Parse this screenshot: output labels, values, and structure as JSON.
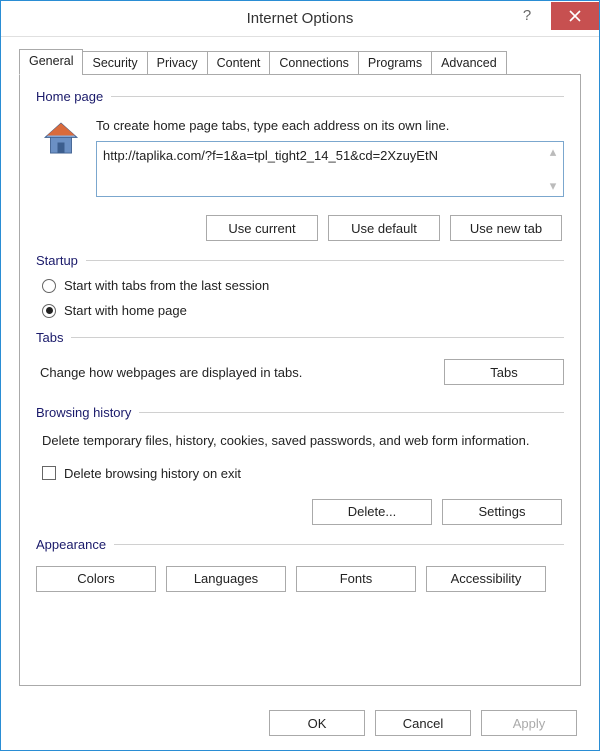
{
  "title": "Internet Options",
  "tabs": {
    "general": "General",
    "security": "Security",
    "privacy": "Privacy",
    "content": "Content",
    "connections": "Connections",
    "programs": "Programs",
    "advanced": "Advanced"
  },
  "homepage": {
    "label": "Home page",
    "desc": "To create home page tabs, type each address on its own line.",
    "url": "http://taplika.com/?f=1&a=tpl_tight2_14_51&cd=2XzuyEtN",
    "use_current": "Use current",
    "use_default": "Use default",
    "use_new_tab": "Use new tab"
  },
  "startup": {
    "label": "Startup",
    "opt_last": "Start with tabs from the last session",
    "opt_home": "Start with home page"
  },
  "tabs_section": {
    "label": "Tabs",
    "desc": "Change how webpages are displayed in tabs.",
    "button": "Tabs"
  },
  "history": {
    "label": "Browsing history",
    "desc": "Delete temporary files, history, cookies, saved passwords, and web form information.",
    "check": "Delete browsing history on exit",
    "delete": "Delete...",
    "settings": "Settings"
  },
  "appearance": {
    "label": "Appearance",
    "colors": "Colors",
    "languages": "Languages",
    "fonts": "Fonts",
    "accessibility": "Accessibility"
  },
  "buttons": {
    "ok": "OK",
    "cancel": "Cancel",
    "apply": "Apply"
  }
}
